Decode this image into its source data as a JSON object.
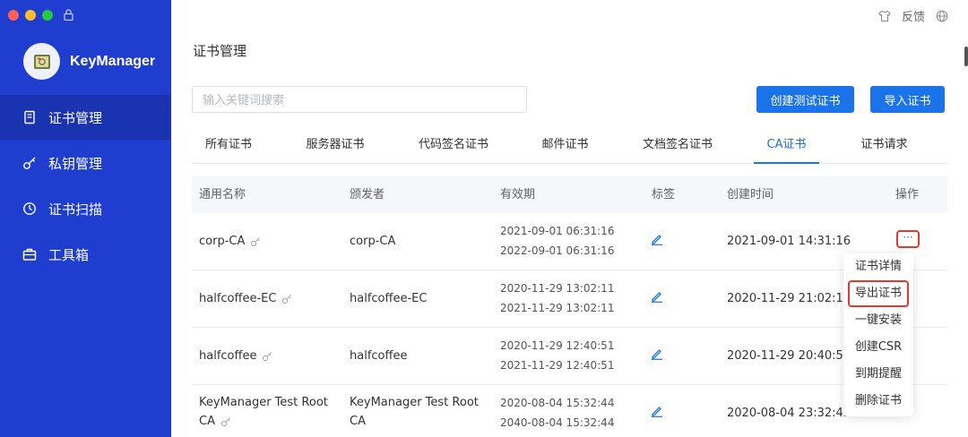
{
  "app": {
    "name": "KeyManager"
  },
  "sidebar": {
    "items": [
      {
        "label": "证书管理",
        "icon": "certificate-icon",
        "active": true
      },
      {
        "label": "私钥管理",
        "icon": "key-icon",
        "active": false
      },
      {
        "label": "证书扫描",
        "icon": "scan-icon",
        "active": false
      },
      {
        "label": "工具箱",
        "icon": "toolbox-icon",
        "active": false
      }
    ]
  },
  "topbar": {
    "feedback_label": "反馈"
  },
  "main": {
    "title": "证书管理",
    "search": {
      "placeholder": "输入关键词搜索",
      "value": ""
    },
    "buttons": {
      "create_test_cert": "创建测试证书",
      "import_cert": "导入证书"
    },
    "tabs": [
      {
        "label": "所有证书",
        "active": false
      },
      {
        "label": "服务器证书",
        "active": false
      },
      {
        "label": "代码签名证书",
        "active": false
      },
      {
        "label": "邮件证书",
        "active": false
      },
      {
        "label": "文档签名证书",
        "active": false
      },
      {
        "label": "CA证书",
        "active": true
      },
      {
        "label": "证书请求",
        "active": false
      }
    ]
  },
  "table": {
    "columns": [
      "通用名称",
      "颁发者",
      "有效期",
      "标签",
      "创建时间",
      "操作"
    ],
    "rows": [
      {
        "name": "corp-CA",
        "issuer": "corp-CA",
        "valid_from": "2021-09-01 06:31:16",
        "valid_to": "2022-09-01 06:31:16",
        "created": "2021-09-01 14:31:16"
      },
      {
        "name": "halfcoffee-EC",
        "issuer": "halfcoffee-EC",
        "valid_from": "2020-11-29 13:02:11",
        "valid_to": "2021-11-29 13:02:11",
        "created": "2020-11-29 21:02:11"
      },
      {
        "name": "halfcoffee",
        "issuer": "halfcoffee",
        "valid_from": "2020-11-29 12:40:51",
        "valid_to": "2021-11-29 12:40:51",
        "created": "2020-11-29 20:40:51"
      },
      {
        "name": "KeyManager Test Root CA",
        "issuer": "KeyManager Test Root CA",
        "valid_from": "2020-08-04 15:32:44",
        "valid_to": "2040-08-04 15:32:44",
        "created": "2020-08-04 23:32:45"
      }
    ],
    "more_label": "···"
  },
  "dropdown": {
    "items": [
      "证书详情",
      "导出证书",
      "一键安装",
      "创建CSR",
      "到期提醒",
      "删除证书"
    ]
  },
  "colors": {
    "sidebar_bg": "#1f3ecf",
    "sidebar_active": "#1a33b0",
    "accent": "#1a73e8",
    "highlight": "#e53b2c"
  }
}
